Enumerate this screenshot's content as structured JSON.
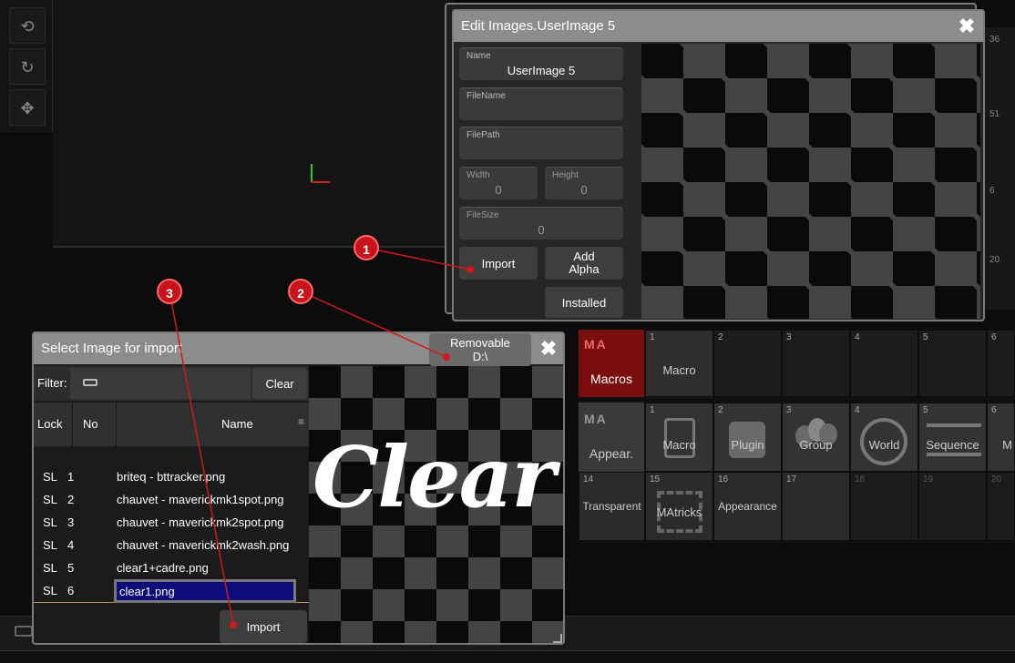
{
  "edit_window": {
    "title": "Edit Images.UserImage 5",
    "name_label": "Name",
    "name_value": "UserImage 5",
    "filename_label": "FileName",
    "filename_value": "",
    "filepath_label": "FilePath",
    "filepath_value": "",
    "width_label": "Width",
    "width_value": "0",
    "height_label": "Height",
    "height_value": "0",
    "filesize_label": "FileSize",
    "filesize_value": "0",
    "import_label": "Import",
    "add_alpha_label": "Add Alpha",
    "installed_label": "Installed"
  },
  "select_window": {
    "title": "Select Image for import",
    "removable_label": "Removable",
    "removable_drive": "D:\\",
    "filter_label": "Filter:",
    "clear_button": "Clear",
    "columns": [
      "Lock",
      "No",
      "Name"
    ],
    "rows": [
      {
        "lock": "SL",
        "no": "1",
        "name": "briteq - bttracker.png"
      },
      {
        "lock": "SL",
        "no": "2",
        "name": "chauvet - maverickmk1spot.png"
      },
      {
        "lock": "SL",
        "no": "3",
        "name": "chauvet - maverickmk2spot.png"
      },
      {
        "lock": "SL",
        "no": "4",
        "name": "chauvet - maverickmk2wash.png"
      },
      {
        "lock": "SL",
        "no": "5",
        "name": "clear1+cadre.png"
      },
      {
        "lock": "SL",
        "no": "6",
        "name": "clear1.png"
      }
    ],
    "selected_row": 6,
    "import_button": "Import",
    "preview_text": "Clear"
  },
  "markers": [
    "1",
    "2",
    "3"
  ],
  "pool": {
    "macros_title": "Macros",
    "macros_icon": "MA",
    "macro_tile": {
      "num": "1",
      "label": "Macro"
    },
    "macro_empty_nums": [
      "2",
      "3",
      "4",
      "5",
      "6"
    ],
    "appear_title": "Appear.",
    "appear_icon": "MA",
    "image_tiles": [
      {
        "num": "1",
        "label": "Macro",
        "icon": "scroll-icon"
      },
      {
        "num": "2",
        "label": "Plugin",
        "icon": "puzzle-icon"
      },
      {
        "num": "3",
        "label": "Group",
        "icon": "bulbs-icon"
      },
      {
        "num": "4",
        "label": "World",
        "icon": "globe-icon"
      },
      {
        "num": "5",
        "label": "Sequence",
        "icon": "lines-icon"
      },
      {
        "num": "6",
        "label": "M",
        "icon": "ma-icon"
      }
    ],
    "row2_tiles": [
      {
        "num": "14",
        "label": "Transparent"
      },
      {
        "num": "15",
        "label": "MAtricks"
      },
      {
        "num": "16",
        "label": "Appearance"
      },
      {
        "num": "17",
        "label": ""
      },
      {
        "num": "18",
        "label": ""
      },
      {
        "num": "19",
        "label": ""
      },
      {
        "num": "20",
        "label": ""
      }
    ]
  },
  "background_numbers": [
    "36",
    "51",
    "6",
    "20"
  ]
}
